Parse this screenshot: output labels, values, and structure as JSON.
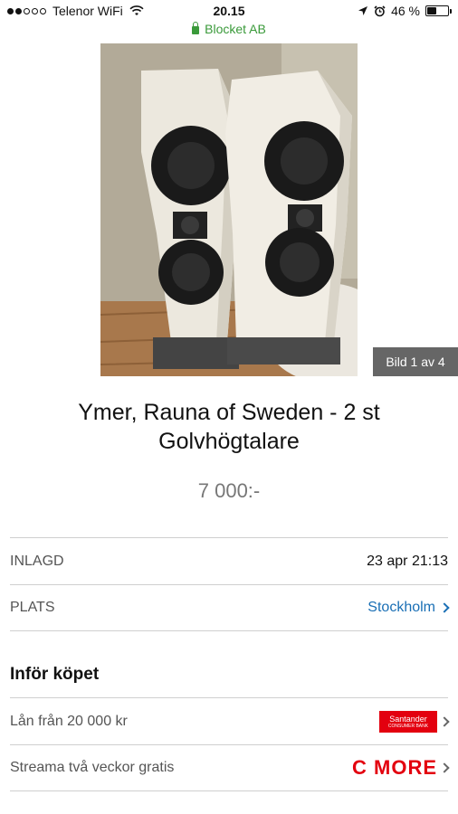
{
  "status_bar": {
    "carrier": "Telenor WiFi",
    "time": "20.15",
    "battery": "46 %",
    "battery_level": 0.46
  },
  "browser": {
    "domain": "Blocket AB"
  },
  "gallery": {
    "counter": "Bild 1 av 4"
  },
  "listing": {
    "title": "Ymer, Rauna of Sweden - 2 st Golvhögtalare",
    "price": "7 000:-"
  },
  "details": [
    {
      "label": "INLAGD",
      "value": "23 apr 21:13"
    },
    {
      "label": "PLATS",
      "value": "Stockholm"
    }
  ],
  "before_purchase": {
    "title": "Inför köpet",
    "items": [
      {
        "label": "Lån från 20 000 kr",
        "logo": "Santander",
        "logo_sub": "CONSUMER BANK"
      },
      {
        "label": "Streama två veckor gratis",
        "logo": "C MORE"
      }
    ]
  },
  "colors": {
    "link": "#1a6fb5",
    "secure": "#3a9a3a",
    "brand_red": "#e3000f"
  }
}
